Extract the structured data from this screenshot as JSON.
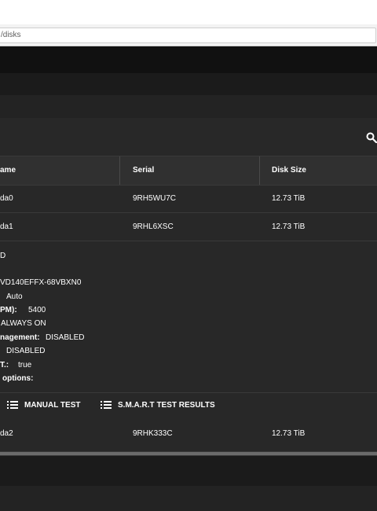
{
  "browser": {
    "url_fragment": "/disks"
  },
  "table": {
    "columns": [
      "ame",
      "Serial",
      "Disk Size"
    ],
    "rows": [
      {
        "name": "da0",
        "serial": "9RH5WU7C",
        "size": "12.73 TiB"
      },
      {
        "name": "da1",
        "serial": "9RHL6XSC",
        "size": "12.73 TiB"
      },
      {
        "name": "da2",
        "serial": "9RHK333C",
        "size": "12.73 TiB"
      }
    ]
  },
  "details": {
    "line1": "D",
    "model": "VD140EFFX-68VBXN0",
    "transfer_value": "Auto",
    "rpm_label": "PM):",
    "rpm_value": "5400",
    "standby_value": "ALWAYS ON",
    "power_label": "nagement:",
    "power_value": "DISABLED",
    "acoustic_value": "DISABLED",
    "smart_label": "T.:",
    "smart_value": "true",
    "options_label": "options:"
  },
  "actions": {
    "manual_test": "MANUAL TEST",
    "smart_results": "S.M.A.R.T TEST RESULTS"
  }
}
